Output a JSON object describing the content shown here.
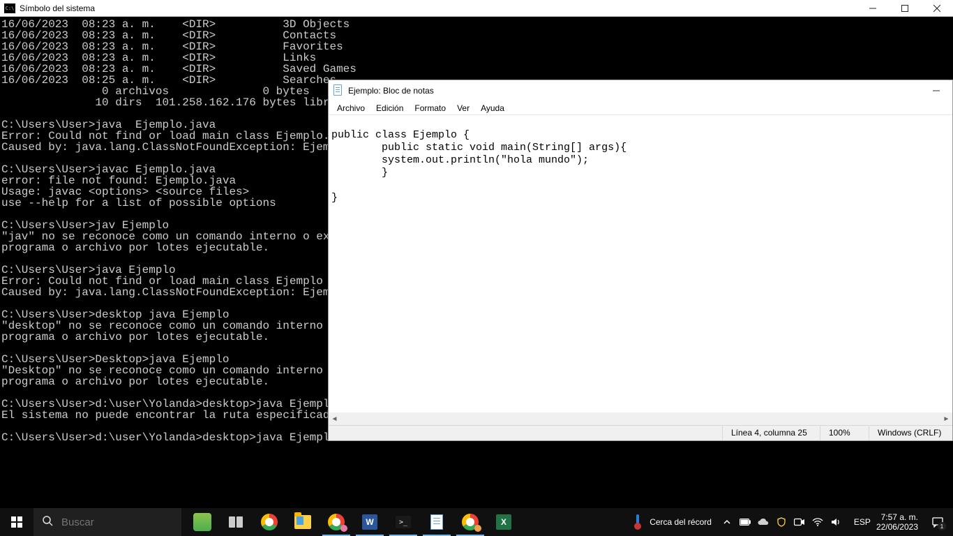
{
  "cmd": {
    "title": "Símbolo del sistema",
    "content": "16/06/2023  08:23 a. m.    <DIR>          3D Objects\n16/06/2023  08:23 a. m.    <DIR>          Contacts\n16/06/2023  08:23 a. m.    <DIR>          Favorites\n16/06/2023  08:23 a. m.    <DIR>          Links\n16/06/2023  08:23 a. m.    <DIR>          Saved Games\n16/06/2023  08:25 a. m.    <DIR>          Searches\n               0 archivos              0 bytes\n              10 dirs  101.258.162.176 bytes libres\n\nC:\\Users\\User>java  Ejemplo.java\nError: Could not find or load main class Ejemplo.java\nCaused by: java.lang.ClassNotFoundException: Ejemplo.java\n\nC:\\Users\\User>javac Ejemplo.java\nerror: file not found: Ejemplo.java\nUsage: javac <options> <source files>\nuse --help for a list of possible options\n\nC:\\Users\\User>jav Ejemplo\n\"jav\" no se reconoce como un comando interno o externo,\nprograma o archivo por lotes ejecutable.\n\nC:\\Users\\User>java Ejemplo\nError: Could not find or load main class Ejemplo\nCaused by: java.lang.ClassNotFoundException: Ejemplo\n\nC:\\Users\\User>desktop java Ejemplo\n\"desktop\" no se reconoce como un comando interno o externo,\nprograma o archivo por lotes ejecutable.\n\nC:\\Users\\User>Desktop>java Ejemplo\n\"Desktop\" no se reconoce como un comando interno o externo,\nprograma o archivo por lotes ejecutable.\n\nC:\\Users\\User>d:\\user\\Yolanda>desktop>java Ejemplo\nEl sistema no puede encontrar la ruta especificada.\n\nC:\\Users\\User>d:\\user\\Yolanda>desktop>java Ejemplo"
  },
  "notepad": {
    "title": "Ejemplo: Bloc de notas",
    "menus": {
      "file": "Archivo",
      "edit": "Edición",
      "format": "Formato",
      "view": "Ver",
      "help": "Ayuda"
    },
    "content": "\npublic class Ejemplo {\n        public static void main(String[] args){\n        system.out.println(\"hola mundo\");\n        }\n\n}",
    "status": {
      "position": "Línea 4, columna 25",
      "zoom": "100%",
      "encoding": "Windows (CRLF)"
    }
  },
  "taskbar": {
    "search_placeholder": "Buscar",
    "weather_text": "Cerca del récord",
    "language": "ESP",
    "time": "7:57 a. m.",
    "date": "22/06/2023",
    "notif_count": "1"
  }
}
